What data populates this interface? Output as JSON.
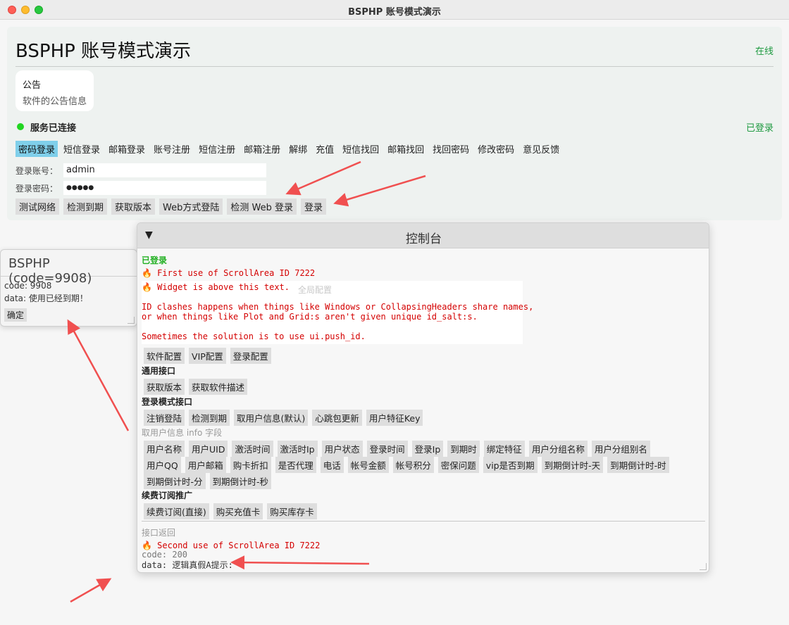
{
  "window": {
    "title": "BSPHP 账号模式演示"
  },
  "header": {
    "title": "BSPHP 账号模式演示",
    "online": "在线"
  },
  "notice": {
    "title": "公告",
    "body": "软件的公告信息"
  },
  "status": {
    "service": "服务已连接",
    "logged_in": "已登录"
  },
  "tabs": [
    "密码登录",
    "短信登录",
    "邮箱登录",
    "账号注册",
    "短信注册",
    "邮箱注册",
    "解绑",
    "充值",
    "短信找回",
    "邮箱找回",
    "找回密码",
    "修改密码",
    "意见反馈"
  ],
  "form": {
    "account_label": "登录账号：",
    "account_value": "admin",
    "password_label": "登录密码：",
    "password_value": "●●●●●"
  },
  "actions": [
    "测试网络",
    "检测到期",
    "获取版本",
    "Web方式登陆",
    "检测 Web 登录",
    "登录"
  ],
  "dialog": {
    "title": "BSPHP (code=9908)",
    "code": "code: 9908",
    "data": "data: 使用已经到期！",
    "ok": "确定"
  },
  "console": {
    "title": "控制台",
    "logged": "已登录",
    "warn1": "🔥 First use of ScrollArea ID 7222",
    "warn2": "🔥 Widget is above this text.",
    "ghost_global": "全局配置",
    "warn3": "ID clashes happens when things like Windows or CollapsingHeaders share names,",
    "warn4": "or when things like Plot and Grid:s aren't given unique id_salt:s.",
    "warn5": "Sometimes the solution is to use ui.push_id.",
    "config_buttons": [
      "软件配置",
      "VIP配置",
      "登录配置"
    ],
    "general_title": "通用接口",
    "general_buttons": [
      "获取版本",
      "获取软件描述"
    ],
    "login_title": "登录模式接口",
    "login_buttons": [
      "注销登陆",
      "检测到期",
      "取用户信息(默认)",
      "心跳包更新",
      "用户特征Key"
    ],
    "info_title": "取用户信息 info 字段",
    "info_row1": [
      "用户名称",
      "用户UID",
      "激活时间",
      "激活时Ip",
      "用户状态",
      "登录时间",
      "登录Ip",
      "到期时",
      "绑定特征",
      "用户分组名称",
      "用户分组别名"
    ],
    "info_row2": [
      "用户QQ",
      "用户邮箱",
      "购卡折扣",
      "是否代理",
      "电话",
      "帐号金额",
      "帐号积分",
      "密保问题",
      "vip是否到期",
      "到期倒计时-天",
      "到期倒计时-时"
    ],
    "info_row3": [
      "到期倒计时-分",
      "到期倒计时-秒"
    ],
    "renew_title": "续费订阅推广",
    "renew_buttons": [
      "续费订阅(直接)",
      "购买充值卡",
      "购买库存卡"
    ],
    "return_title": "接口返回",
    "warn6": "🔥 Second use of ScrollArea ID 7222",
    "ret_code": "code: 200",
    "ret_data": "data: 逻辑真假A提示:"
  },
  "colors": {
    "accent_tab": "#7fcfea",
    "online_green": "#1e9a40",
    "warn_red": "#d40000",
    "arrow_red": "#f05050"
  }
}
